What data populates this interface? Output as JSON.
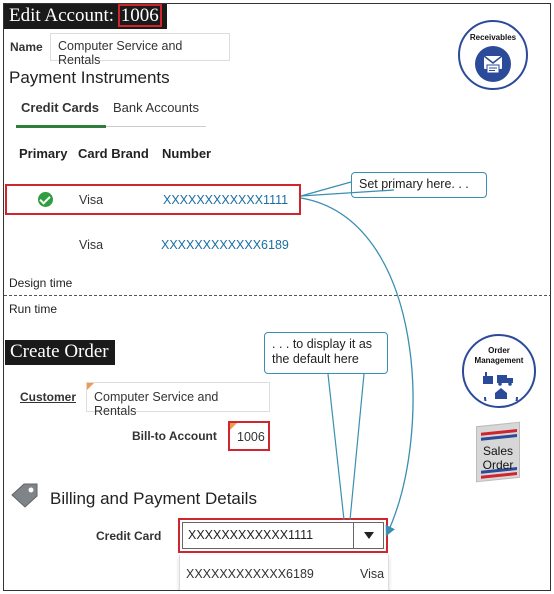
{
  "edit_account": {
    "title": "Edit Account:",
    "account_number": "1006",
    "name_label": "Name",
    "name_value": "Computer Service and Rentals",
    "section_title": "Payment Instruments",
    "tabs": [
      {
        "label": "Credit Cards",
        "active": true
      },
      {
        "label": "Bank Accounts",
        "active": false
      }
    ],
    "columns": [
      "Primary",
      "Card Brand",
      "Number"
    ],
    "rows": [
      {
        "primary": true,
        "brand": "Visa",
        "number": "XXXXXXXXXXXX1111"
      },
      {
        "primary": false,
        "brand": "Visa",
        "number": "XXXXXXXXXXXX6189"
      }
    ]
  },
  "callouts": {
    "set_primary": "Set primary here. . .",
    "display_default": ". . . to display it as the default here"
  },
  "phase_labels": {
    "design": "Design time",
    "run": "Run time"
  },
  "create_order": {
    "title": "Create Order",
    "customer_label": "Customer",
    "customer_value": "Computer Service and Rentals",
    "bill_to_label": "Bill-to Account",
    "bill_to_value": "1006",
    "billing_section": "Billing and Payment Details",
    "credit_card_label": "Credit Card",
    "credit_card_value": "XXXXXXXXXXXX1111",
    "dropdown_options": [
      {
        "number": "XXXXXXXXXXXX6189",
        "brand": "Visa"
      }
    ]
  },
  "badges": {
    "receivables": "Receivables",
    "order_management": [
      "Order",
      "Management"
    ],
    "sales_order": [
      "Sales",
      "Order"
    ]
  },
  "colors": {
    "highlight": "#d0242e",
    "link": "#1a6ea3",
    "callout_border": "#3a8fb0",
    "badge_blue": "#2c4a9a",
    "primary_check": "#2f9e41",
    "required_marker": "#f29b4d"
  },
  "icons": {
    "receivables": "envelope-document-icon",
    "order_management": "factory-truck-house-icon",
    "billing": "tag-icon",
    "dropdown": "chevron-down-icon",
    "primary": "check-circle-icon"
  }
}
